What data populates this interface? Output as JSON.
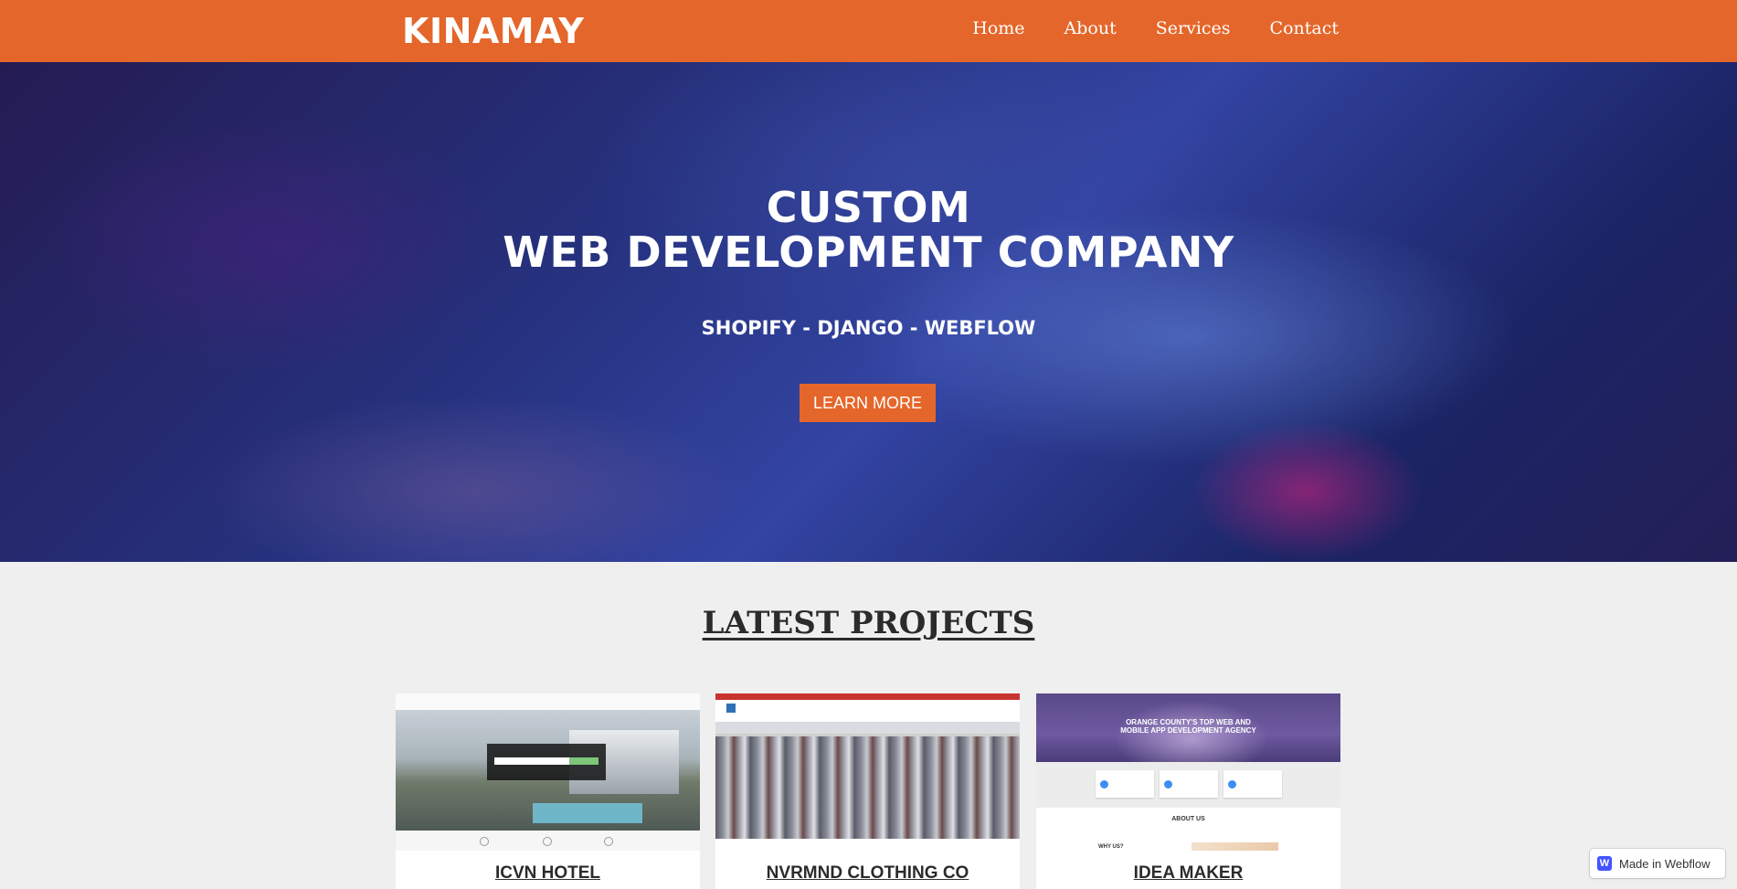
{
  "navbar": {
    "brand": "KINAMAY",
    "links": [
      "Home",
      "About",
      "Services",
      "Contact"
    ]
  },
  "hero": {
    "title_line1": "CUSTOM",
    "title_line2": "WEB DEVELOPMENT COMPANY",
    "subtitle": "SHOPIFY - DJANGO - WEBFLOW",
    "cta_label": "LEARN MORE"
  },
  "projects": {
    "heading": "LATEST PROJECTS",
    "items": [
      {
        "title": "ICVN HOTEL"
      },
      {
        "title": "NVRMND CLOTHING CO"
      },
      {
        "title": "IDEA MAKER"
      }
    ],
    "thumb3": {
      "headline_line1": "ORANGE COUNTY'S TOP WEB AND",
      "headline_line2": "MOBILE APP DEVELOPMENT AGENCY",
      "about": "ABOUT US",
      "why": "WHY US?"
    }
  },
  "badge": {
    "label": "Made in Webflow",
    "logo_letter": "W"
  },
  "colors": {
    "accent": "#e5662a",
    "background": "#efefef"
  }
}
